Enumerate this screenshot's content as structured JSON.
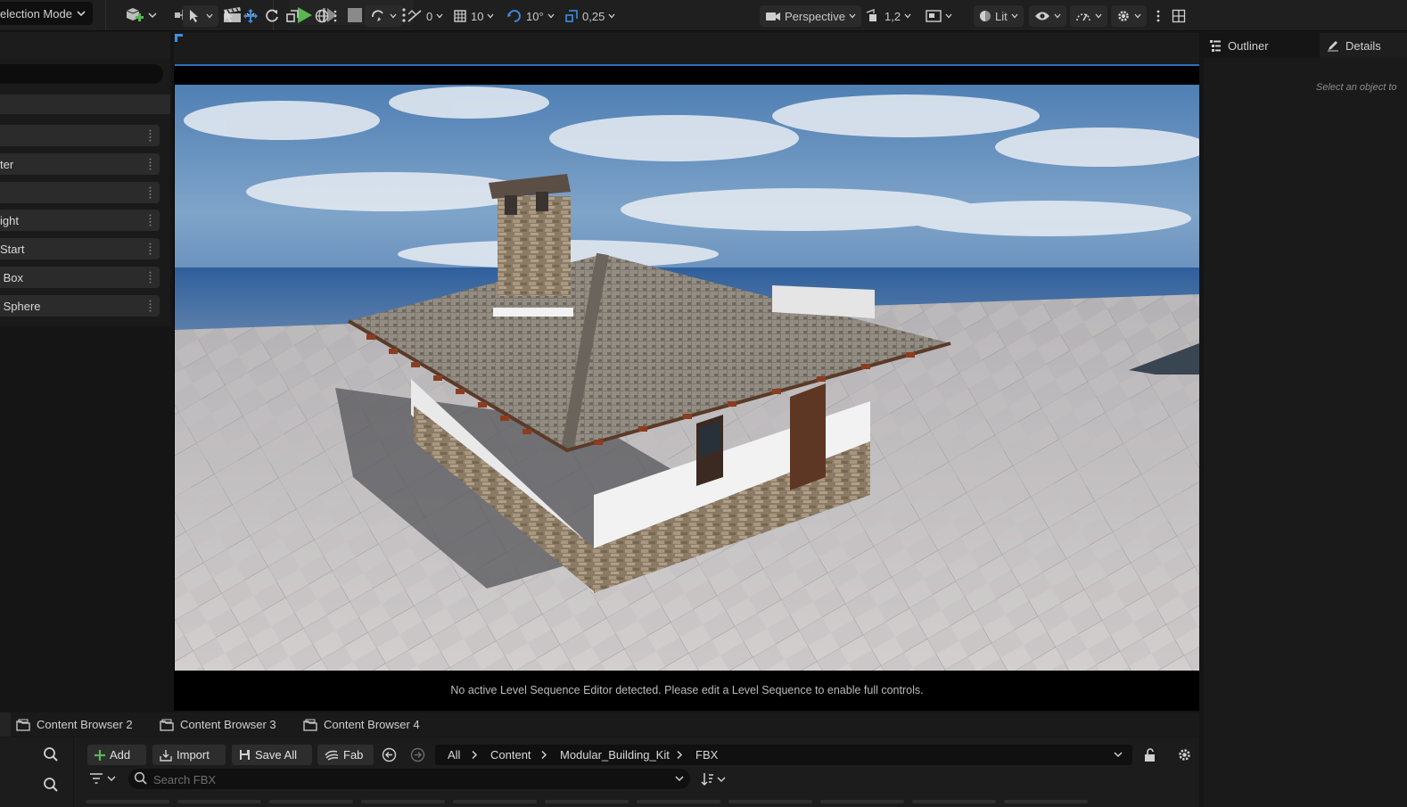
{
  "toolbar": {
    "mode_label": "election Mode",
    "icons": [
      "add-actor-icon",
      "blueprint-icon",
      "cinematics-icon",
      "play-icon",
      "step-icon",
      "stop-icon",
      "eject-icon",
      "more-vertical-icon"
    ]
  },
  "place_actors": {
    "items": [
      {
        "label": ""
      },
      {
        "label": "ter"
      },
      {
        "label": ""
      },
      {
        "label": "ight"
      },
      {
        "label": "Start"
      },
      {
        "label": " Box"
      },
      {
        "label": " Sphere"
      }
    ]
  },
  "viewport": {
    "translate_snap": "0",
    "grid_snap": "10",
    "rotation_snap": "10°",
    "scale_snap": "0,25",
    "view_mode_label": "Perspective",
    "camera_speed": "1,2",
    "lighting_mode": "Lit",
    "sequence_message": "No active Level Sequence Editor detected. Please edit a Level Sequence to enable full controls."
  },
  "right_panel": {
    "outliner_tab": "Outliner",
    "details_tab": "Details",
    "hint": "Select an object to"
  },
  "content_browser": {
    "tabs": [
      "Content Browser 2",
      "Content Browser 3",
      "Content Browser 4"
    ],
    "add_label": "Add",
    "import_label": "Import",
    "save_all_label": "Save All",
    "fab_label": "Fab",
    "breadcrumb": [
      "All",
      "Content",
      "Modular_Building_Kit",
      "FBX"
    ],
    "search_placeholder": "Search FBX"
  },
  "colors": {
    "accent_green": "#5ab552",
    "accent_blue": "#3f8fe0",
    "panel_bg": "#1a1a1a"
  }
}
